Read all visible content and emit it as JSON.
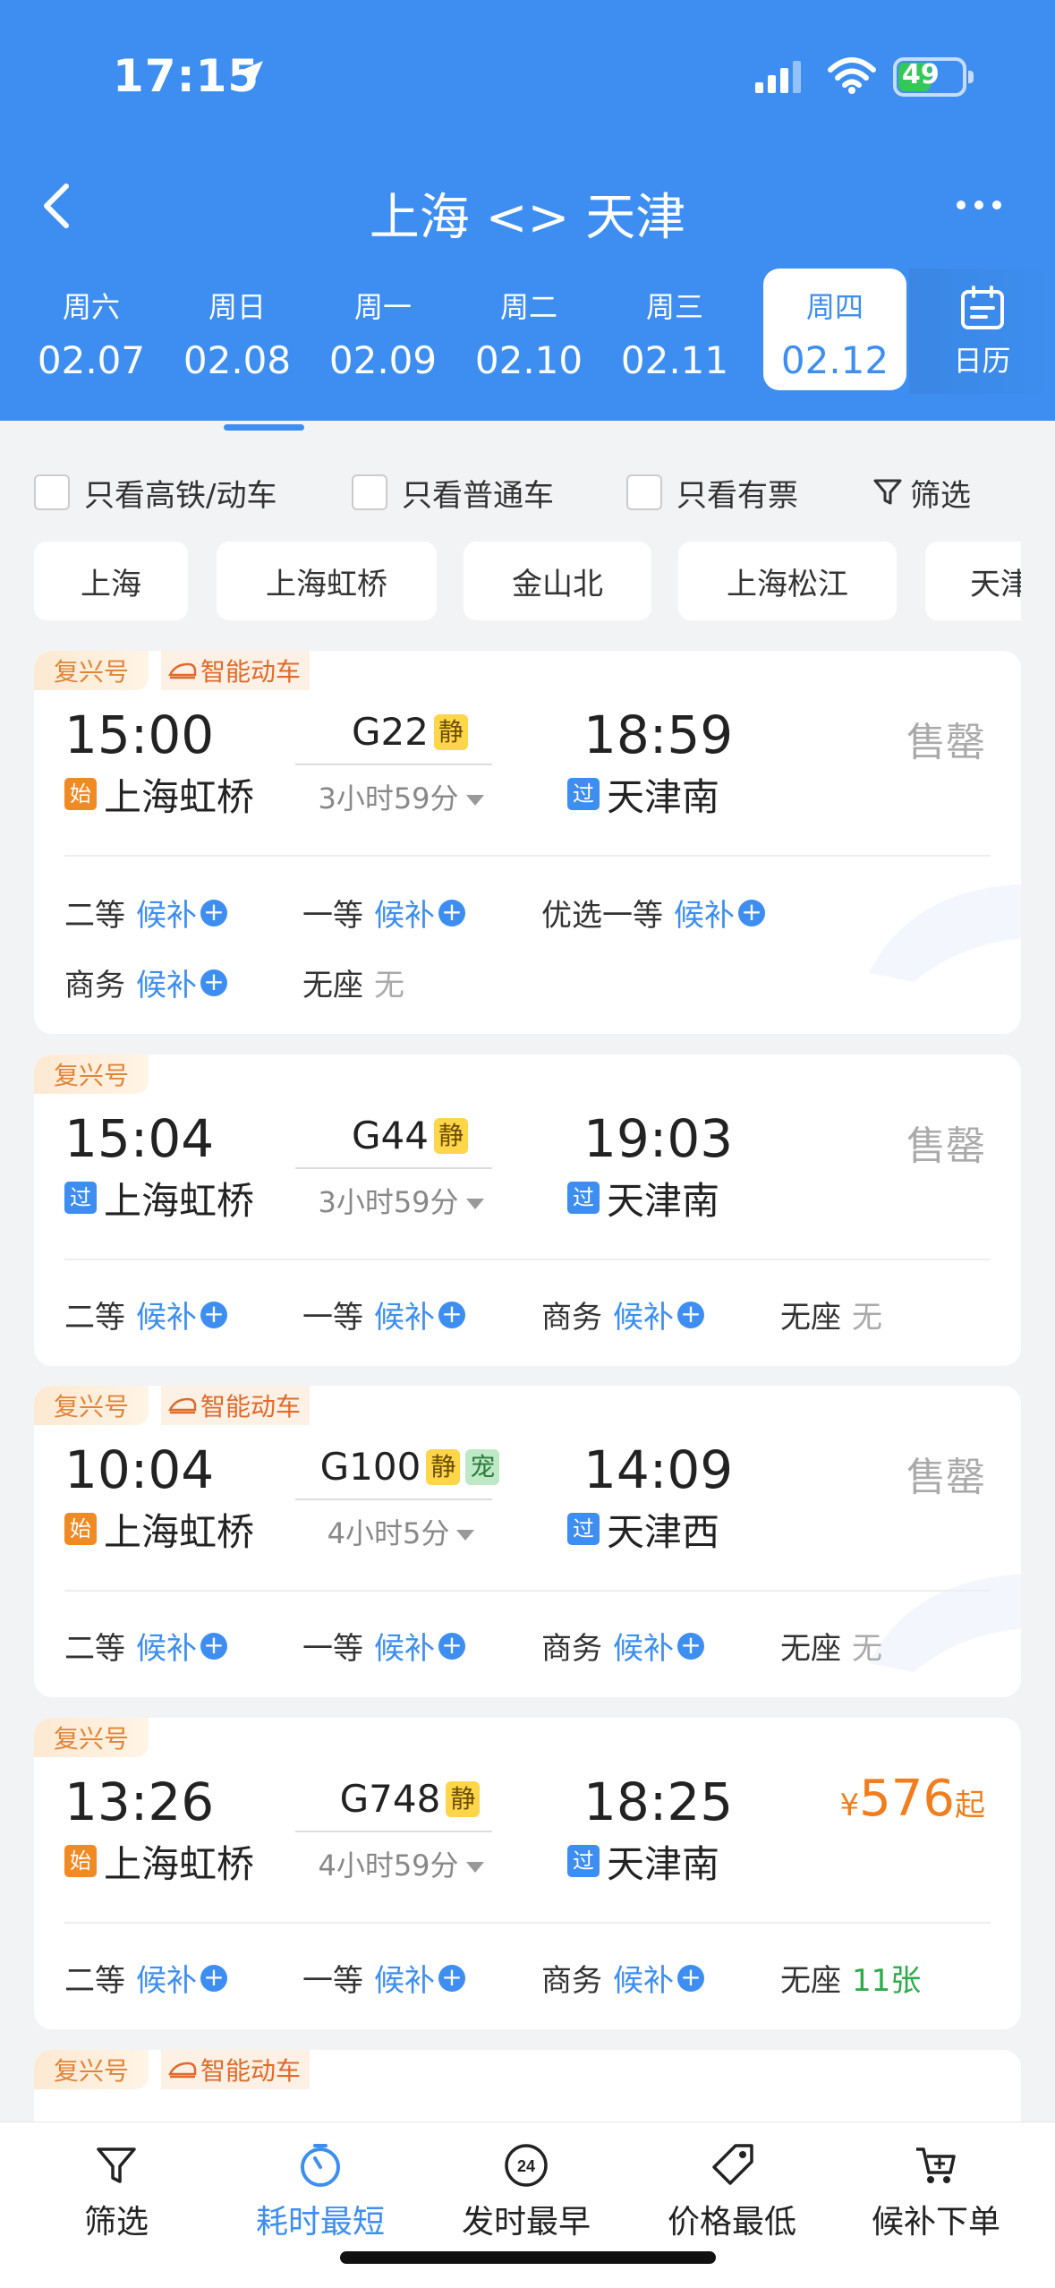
{
  "status_bar": {
    "time": "17:15",
    "battery": "49"
  },
  "header": {
    "title": "上海 <> 天津",
    "dates": [
      {
        "dow": "周六",
        "date": "02.07",
        "selected": false
      },
      {
        "dow": "周日",
        "date": "02.08",
        "selected": false
      },
      {
        "dow": "周一",
        "date": "02.09",
        "selected": false
      },
      {
        "dow": "周二",
        "date": "02.10",
        "selected": false
      },
      {
        "dow": "周三",
        "date": "02.11",
        "selected": false
      },
      {
        "dow": "周四",
        "date": "02.12",
        "selected": true
      }
    ],
    "calendar_label": "日历"
  },
  "filters": {
    "only_highspeed": "只看高铁/动车",
    "only_normal": "只看普通车",
    "only_available": "只看有票",
    "filter": "筛选"
  },
  "stations": [
    "上海",
    "上海虹桥",
    "金山北",
    "上海松江",
    "天津"
  ],
  "trains": [
    {
      "tags": [
        "复兴号",
        "智能动车"
      ],
      "dep_time": "15:00",
      "arr_time": "18:59",
      "train_no": "G22",
      "badges": [
        "静"
      ],
      "duration": "3小时59分",
      "dep_flag": "始",
      "dep_station": "上海虹桥",
      "arr_flag": "过",
      "arr_station": "天津南",
      "status": "售罄",
      "seats": [
        {
          "cls": "二等",
          "val": "候补",
          "type": "wait"
        },
        {
          "cls": "一等",
          "val": "候补",
          "type": "wait"
        },
        {
          "cls": "优选一等",
          "val": "候补",
          "type": "wait"
        },
        {
          "cls": "商务",
          "val": "候补",
          "type": "wait"
        },
        {
          "cls": "无座",
          "val": "无",
          "type": "none"
        }
      ]
    },
    {
      "tags": [
        "复兴号"
      ],
      "dep_time": "15:04",
      "arr_time": "19:03",
      "train_no": "G44",
      "badges": [
        "静"
      ],
      "duration": "3小时59分",
      "dep_flag": "过",
      "dep_station": "上海虹桥",
      "arr_flag": "过",
      "arr_station": "天津南",
      "status": "售罄",
      "seats": [
        {
          "cls": "二等",
          "val": "候补",
          "type": "wait"
        },
        {
          "cls": "一等",
          "val": "候补",
          "type": "wait"
        },
        {
          "cls": "商务",
          "val": "候补",
          "type": "wait"
        },
        {
          "cls": "无座",
          "val": "无",
          "type": "none"
        }
      ]
    },
    {
      "tags": [
        "复兴号",
        "智能动车"
      ],
      "dep_time": "10:04",
      "arr_time": "14:09",
      "train_no": "G100",
      "badges": [
        "静",
        "宠"
      ],
      "duration": "4小时5分",
      "dep_flag": "始",
      "dep_station": "上海虹桥",
      "arr_flag": "过",
      "arr_station": "天津西",
      "status": "售罄",
      "seats": [
        {
          "cls": "二等",
          "val": "候补",
          "type": "wait"
        },
        {
          "cls": "一等",
          "val": "候补",
          "type": "wait"
        },
        {
          "cls": "商务",
          "val": "候补",
          "type": "wait"
        },
        {
          "cls": "无座",
          "val": "无",
          "type": "none"
        }
      ]
    },
    {
      "tags": [
        "复兴号"
      ],
      "dep_time": "13:26",
      "arr_time": "18:25",
      "train_no": "G748",
      "badges": [
        "静"
      ],
      "duration": "4小时59分",
      "dep_flag": "始",
      "dep_station": "上海虹桥",
      "arr_flag": "过",
      "arr_station": "天津南",
      "price": {
        "currency": "¥",
        "amount": "576",
        "suffix": "起"
      },
      "seats": [
        {
          "cls": "二等",
          "val": "候补",
          "type": "wait"
        },
        {
          "cls": "一等",
          "val": "候补",
          "type": "wait"
        },
        {
          "cls": "商务",
          "val": "候补",
          "type": "wait"
        },
        {
          "cls": "无座",
          "val": "11张",
          "type": "count"
        }
      ]
    },
    {
      "tags": [
        "复兴号",
        "智能动车"
      ]
    }
  ],
  "bottom_tabs": [
    {
      "label": "筛选",
      "icon": "funnel-icon",
      "active": false
    },
    {
      "label": "耗时最短",
      "icon": "timer-icon",
      "active": true
    },
    {
      "label": "发时最早",
      "icon": "clock-24-icon",
      "active": false
    },
    {
      "label": "价格最低",
      "icon": "price-tag-icon",
      "active": false
    },
    {
      "label": "候补下单",
      "icon": "cart-plus-icon",
      "active": false
    }
  ],
  "colors": {
    "primary": "#3d8ef0",
    "orange": "#f07d1e",
    "green": "#2eaa4a"
  }
}
